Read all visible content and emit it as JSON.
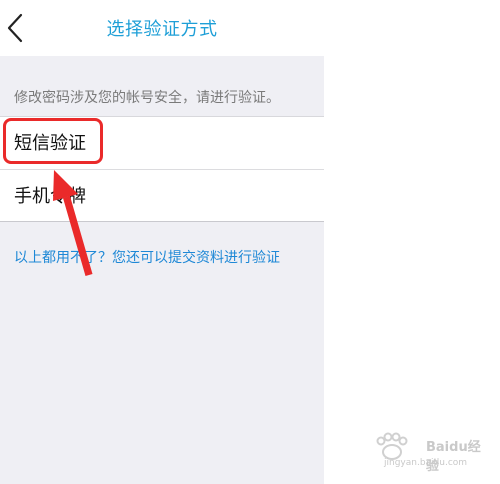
{
  "nav": {
    "title": "选择验证方式"
  },
  "notice": "修改密码涉及您的帐号安全，请进行验证。",
  "options": [
    {
      "label": "短信验证"
    },
    {
      "label": "手机令牌"
    }
  ],
  "alt_link": "以上都用不了？您还可以提交资料进行验证",
  "watermark": {
    "name": "Baidu经验",
    "url": "jingyan.baidu.com"
  },
  "colors": {
    "accent": "#1e9fd7",
    "highlight": "#ea2a2a",
    "background": "#efeff4"
  },
  "icons": [
    "chevron-left-icon",
    "arrow-annotation-icon"
  ]
}
